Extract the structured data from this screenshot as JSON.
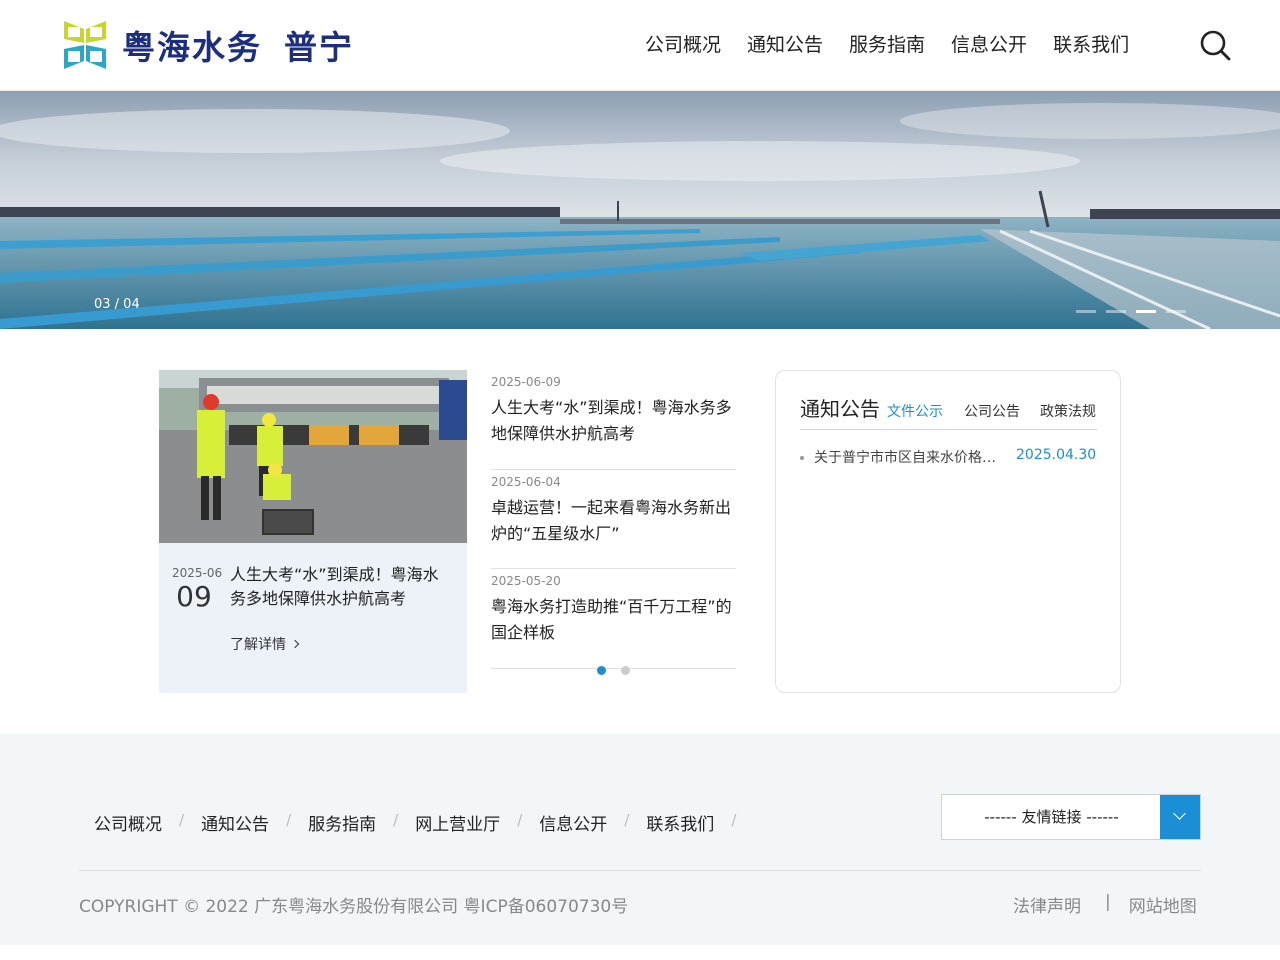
{
  "header": {
    "logo_text": "粤海水务",
    "logo_sub": "普宁",
    "nav": [
      "公司概况",
      "通知公告",
      "服务指南",
      "信息公开",
      "联系我们"
    ],
    "search_icon": "search-icon"
  },
  "banner": {
    "counter": "03 / 04",
    "slide_count": 4,
    "active_slide": 3
  },
  "feature": {
    "year_month": "2025-06",
    "day": "09",
    "title": "人生大考“水”到渠成！粤海水务多地保障供水护航高考",
    "more_label": "了解详情"
  },
  "news": [
    {
      "date": "2025-06-09",
      "title": "人生大考“水”到渠成！粤海水务多地保障供水护航高考"
    },
    {
      "date": "2025-06-04",
      "title": "卓越运营！一起来看粤海水务新出炉的“五星级水厂”"
    },
    {
      "date": "2025-05-20",
      "title": "粤海水务打造助推“百千万工程”的国企样板"
    }
  ],
  "notice": {
    "title": "通知公告",
    "tabs": [
      "文件公示",
      "公司公告",
      "政策法规"
    ],
    "active_tab": 0,
    "items": [
      {
        "text": "关于普宁市市区自来水价格调整的公示",
        "date": "2025.04.30"
      }
    ]
  },
  "footer": {
    "nav": [
      "公司概况",
      "通知公告",
      "服务指南",
      "网上营业厅",
      "信息公开",
      "联系我们"
    ],
    "separator": "/",
    "links_label": "------ 友情链接 ------",
    "copyright": "COPYRIGHT © 2022 广东粤海水务股份有限公司 粤ICP备06070730号",
    "legal": "法律声明",
    "divider": "|",
    "sitemap": "网站地图"
  },
  "colors": {
    "brand_navy": "#1d2e7e",
    "accent_blue": "#1a8fd6",
    "footer_bg": "#f3f6f9",
    "feature_bg": "#ecf2f7"
  }
}
